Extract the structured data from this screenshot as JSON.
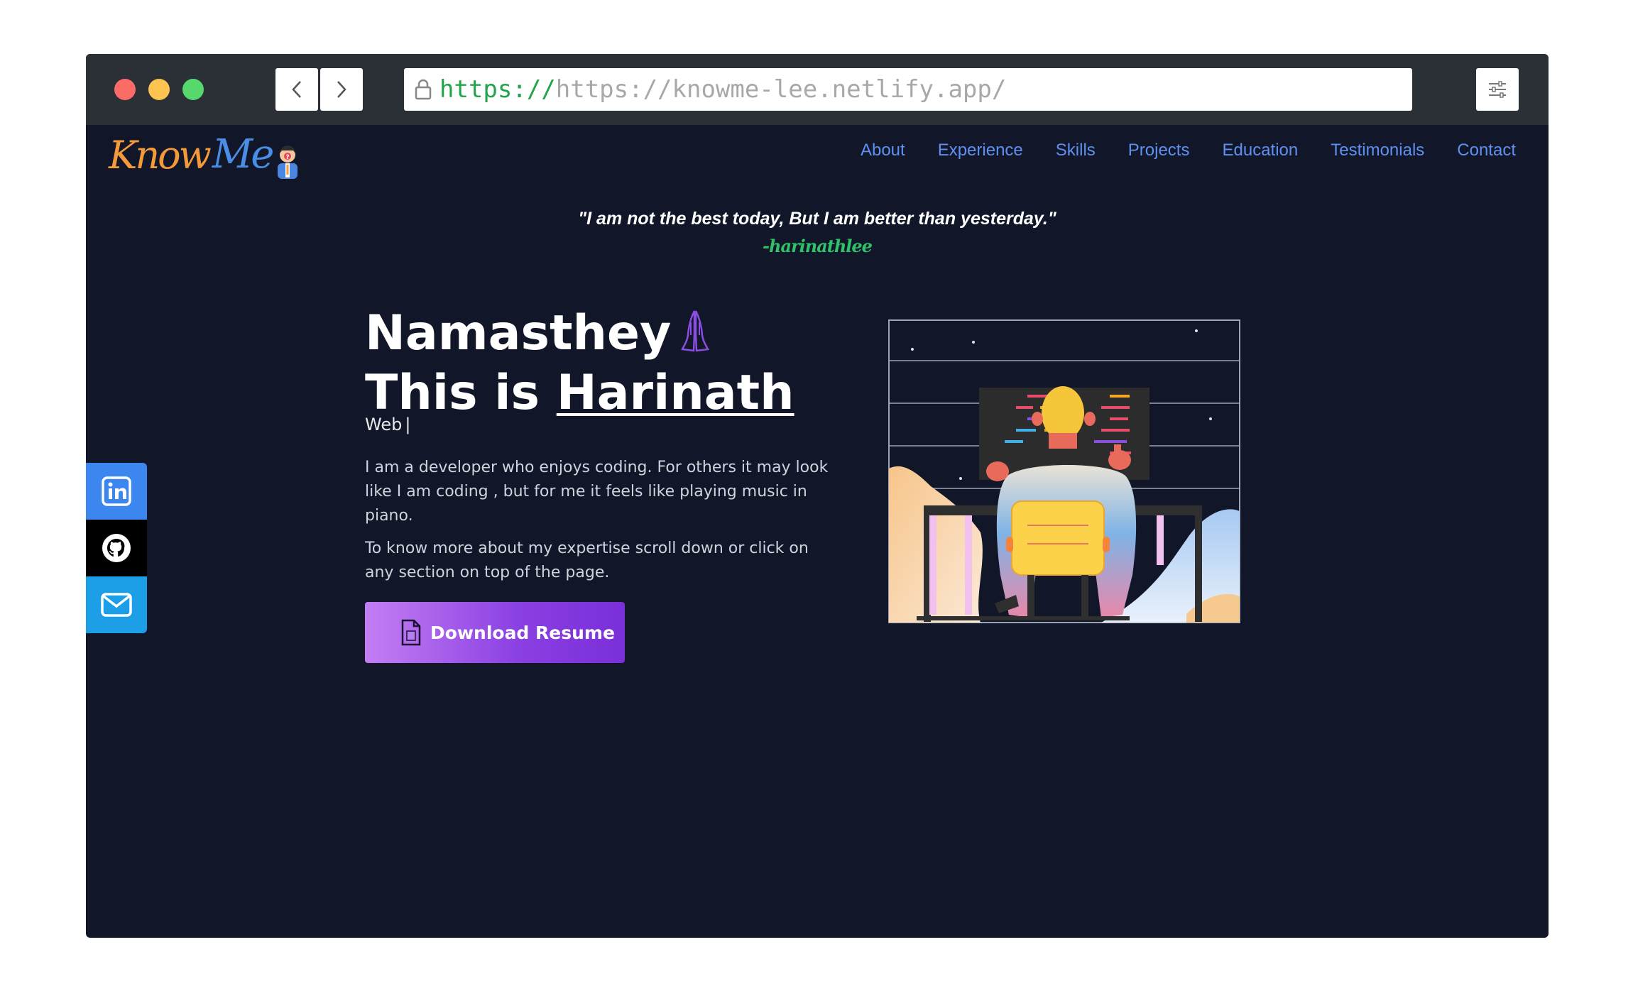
{
  "browser": {
    "url_scheme": "https://",
    "url_rest": "https://knowme-lee.netlify.app/"
  },
  "site": {
    "logo": {
      "know": "Know",
      "me": "Me"
    },
    "nav": [
      "About",
      "Experience",
      "Skills",
      "Projects",
      "Education",
      "Testimonials",
      "Contact"
    ],
    "quote": "\"I am not the best today, But I am better than yesterday.\"",
    "quote_author": "-harinathlee",
    "hero": {
      "greeting": "Namasthey",
      "intro_prefix": "This is ",
      "name": "Harinath",
      "typed_text": "Web",
      "typed_cursor": "|",
      "paragraph1": "I am a developer who enjoys coding. For others it may look like I am coding , but for me it feels like playing music in piano.",
      "paragraph2": "To know more about my expertise scroll down or click on any section on top of the page.",
      "resume_button": "Download Resume"
    },
    "socials": [
      {
        "name": "LinkedIn",
        "icon": "linkedin-icon",
        "color": "#3b86ef"
      },
      {
        "name": "GitHub",
        "icon": "github-icon",
        "color": "#000000"
      },
      {
        "name": "Email",
        "icon": "mail-icon",
        "color": "#1c9fe6"
      }
    ],
    "colors": {
      "background": "#111729",
      "nav_link": "#5f8ff0",
      "quote_author": "#2fc26a",
      "button_gradient_start": "#c47ef3",
      "button_gradient_end": "#7a2fd8"
    }
  }
}
